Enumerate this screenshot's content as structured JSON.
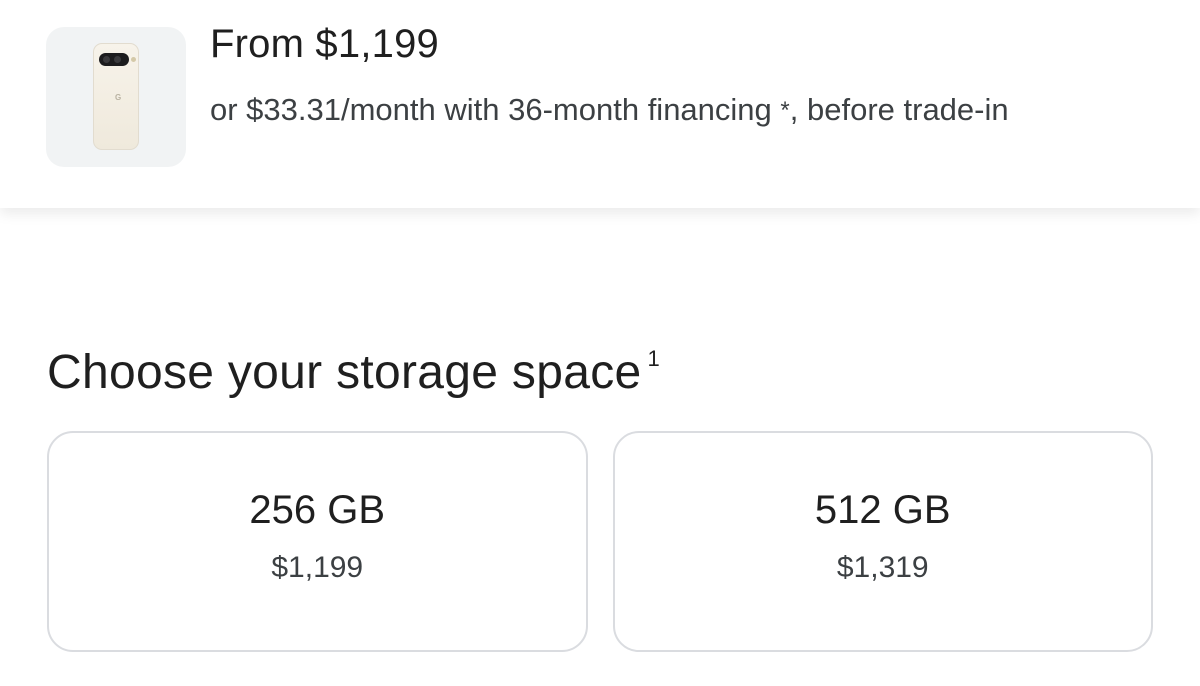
{
  "header": {
    "price_title": "From $1,199",
    "financing_text": "or $33.31/month with 36-month financing",
    "financing_asterisk": "*",
    "financing_suffix": ", before trade-in",
    "product_icon": "phone-thumbnail-icon"
  },
  "storage": {
    "heading": "Choose your storage space",
    "footnote": "1",
    "options": [
      {
        "size": "256 GB",
        "price": "$1,199"
      },
      {
        "size": "512 GB",
        "price": "$1,319"
      }
    ]
  },
  "colors": {
    "text_primary": "#1f1f1f",
    "text_secondary": "#3c4043",
    "card_border": "#dadce0",
    "thumb_bg": "#f1f3f4"
  }
}
